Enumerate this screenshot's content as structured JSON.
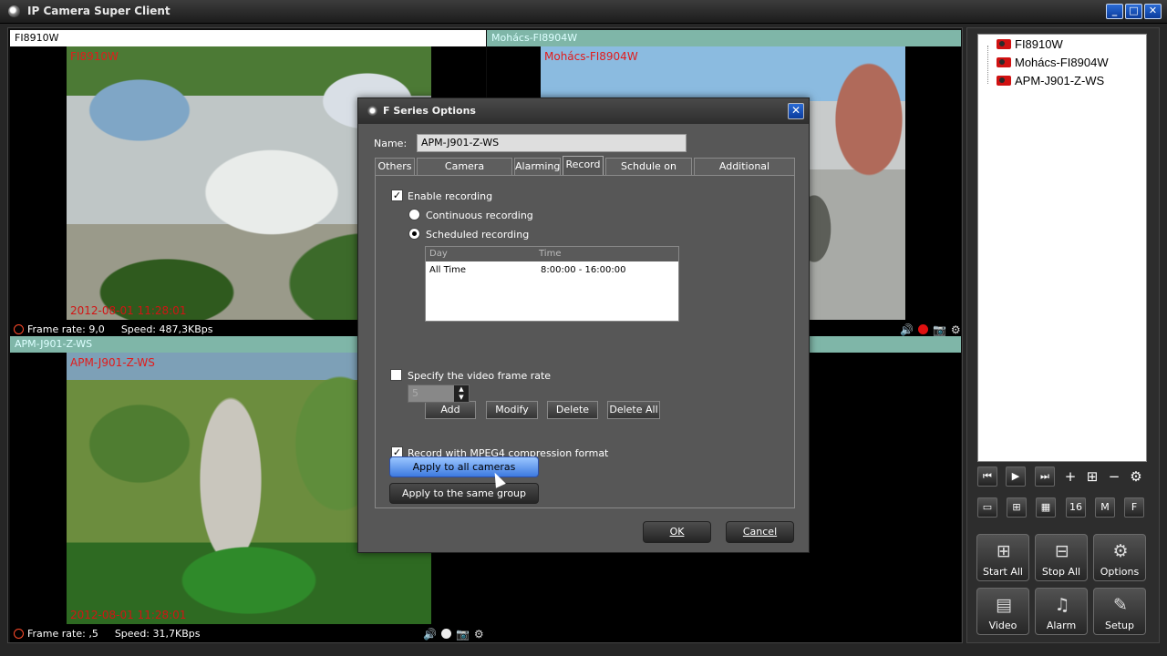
{
  "window": {
    "title": "IP Camera Super Client",
    "min_label": "_",
    "max_label": "□",
    "close_label": "✕"
  },
  "cameras": [
    {
      "header": "FI8910W",
      "overlay_name": "FI8910W",
      "overlay_time": "2012-08-01 11:28:01",
      "frame_rate": "Frame rate: 9,0",
      "speed": "Speed: 487,3KBps"
    },
    {
      "header": "Mohács-FI8904W",
      "overlay_name": "Mohács-FI8904W"
    },
    {
      "header": "APM-J901-Z-WS",
      "overlay_name": "APM-J901-Z-WS",
      "overlay_time": "2012-08-01 11:28:01",
      "frame_rate": "Frame rate: ,5",
      "speed": "Speed: 31,7KBps"
    }
  ],
  "pane_icons": {
    "speaker": "🔊",
    "snapshot": "📷",
    "settings": "⚙"
  },
  "dialog": {
    "title": "F Series Options",
    "close_label": "✕",
    "name_label": "Name:",
    "name_value": "APM-J901-Z-WS",
    "tabs": [
      {
        "label": "Others"
      },
      {
        "label": "Camera Parameters"
      },
      {
        "label": "Alarming"
      },
      {
        "label": "Record"
      },
      {
        "label": "Schdule on Action"
      },
      {
        "label": "Additional Information"
      }
    ],
    "active_tab": "Record",
    "enable_recording": "Enable recording",
    "continuous_recording": "Continuous recording",
    "scheduled_recording": "Scheduled recording",
    "schedule": {
      "columns": [
        "Day",
        "Time"
      ],
      "rows": [
        {
          "day": "All Time",
          "time": "8:00:00 - 16:00:00"
        }
      ]
    },
    "buttons": {
      "add": "Add",
      "modify": "Modify",
      "delete": "Delete",
      "delete_all": "Delete All",
      "apply_all": "Apply to all cameras",
      "apply_group": "Apply to the same group",
      "ok": "OK",
      "cancel": "Cancel"
    },
    "mpeg4": "Record with MPEG4 compression format",
    "frame_rate_option": "Specify the video frame rate",
    "frame_rate_value": "5",
    "check_mark": "✓"
  },
  "sidebar": {
    "devices": [
      {
        "name": "FI8910W"
      },
      {
        "name": "Mohács-FI8904W"
      },
      {
        "name": "APM-J901-Z-WS"
      }
    ],
    "layout_buttons": {
      "sixteen": "16",
      "m": "M",
      "f": "F"
    },
    "action_buttons": [
      {
        "label": "Start All"
      },
      {
        "label": "Stop All"
      },
      {
        "label": "Options"
      },
      {
        "label": "Video"
      },
      {
        "label": "Alarm"
      },
      {
        "label": "Setup"
      }
    ]
  }
}
